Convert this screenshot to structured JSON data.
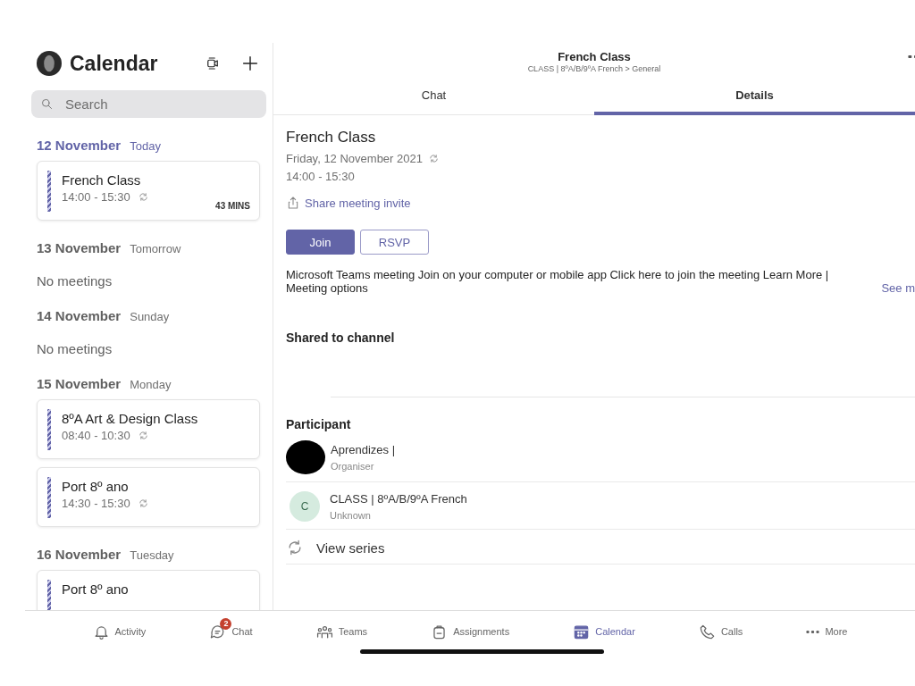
{
  "sidebar": {
    "title": "Calendar",
    "search": {
      "placeholder": "Search"
    },
    "days": [
      {
        "date": "12 November",
        "weekday": "Today",
        "today": true,
        "events": [
          {
            "title": "French Class",
            "time": "14:00 - 15:30",
            "recurring": true,
            "countdown": "43 MINS"
          }
        ]
      },
      {
        "date": "13 November",
        "weekday": "Tomorrow",
        "today": false,
        "empty_text": "No meetings"
      },
      {
        "date": "14 November",
        "weekday": "Sunday",
        "today": false,
        "empty_text": "No meetings"
      },
      {
        "date": "15 November",
        "weekday": "Monday",
        "today": false,
        "events": [
          {
            "title": "8ºA Art & Design Class",
            "time": "08:40 - 10:30",
            "recurring": true
          },
          {
            "title": "Port 8º ano",
            "time": "14:30 - 15:30",
            "recurring": true
          }
        ]
      },
      {
        "date": "16 November",
        "weekday": "Tuesday",
        "today": false,
        "events": [
          {
            "title": "Port 8º ano"
          }
        ]
      }
    ]
  },
  "header": {
    "title": "French Class",
    "subtitle": "CLASS | 8ºA/B/9ºA French > General"
  },
  "tabs": [
    {
      "label": "Chat",
      "selected": false
    },
    {
      "label": "Details",
      "selected": true
    }
  ],
  "details": {
    "title": "French Class",
    "date": "Friday, 12 November 2021",
    "recurring": true,
    "time": "14:00 - 15:30",
    "share_link": "Share meeting invite",
    "buttons": [
      {
        "label": "Join",
        "kind": "primary"
      },
      {
        "label": "RSVP",
        "kind": "outline"
      }
    ],
    "description": "Microsoft Teams meeting Join on your computer or mobile app Click here to join the meeting Learn More | Meeting options",
    "see_more": "See m",
    "shared_heading": "Shared to channel",
    "participants_heading": "Participant",
    "participants": [
      {
        "name": "Aprendizes |",
        "role": "Organiser",
        "kind": "redacted"
      },
      {
        "name": "CLASS | 8ºA/B/9ºA French",
        "role": "Unknown",
        "kind": "initial",
        "initial": "C"
      }
    ],
    "view_series": "View series"
  },
  "bottom_tabs": [
    {
      "label": "Activity",
      "selected": false
    },
    {
      "label": "Chat",
      "selected": false,
      "badge": "2"
    },
    {
      "label": "Teams",
      "selected": false
    },
    {
      "label": "Assignments",
      "selected": false
    },
    {
      "label": "Calendar",
      "selected": true
    },
    {
      "label": "Calls",
      "selected": false
    },
    {
      "label": "More",
      "selected": false
    }
  ]
}
